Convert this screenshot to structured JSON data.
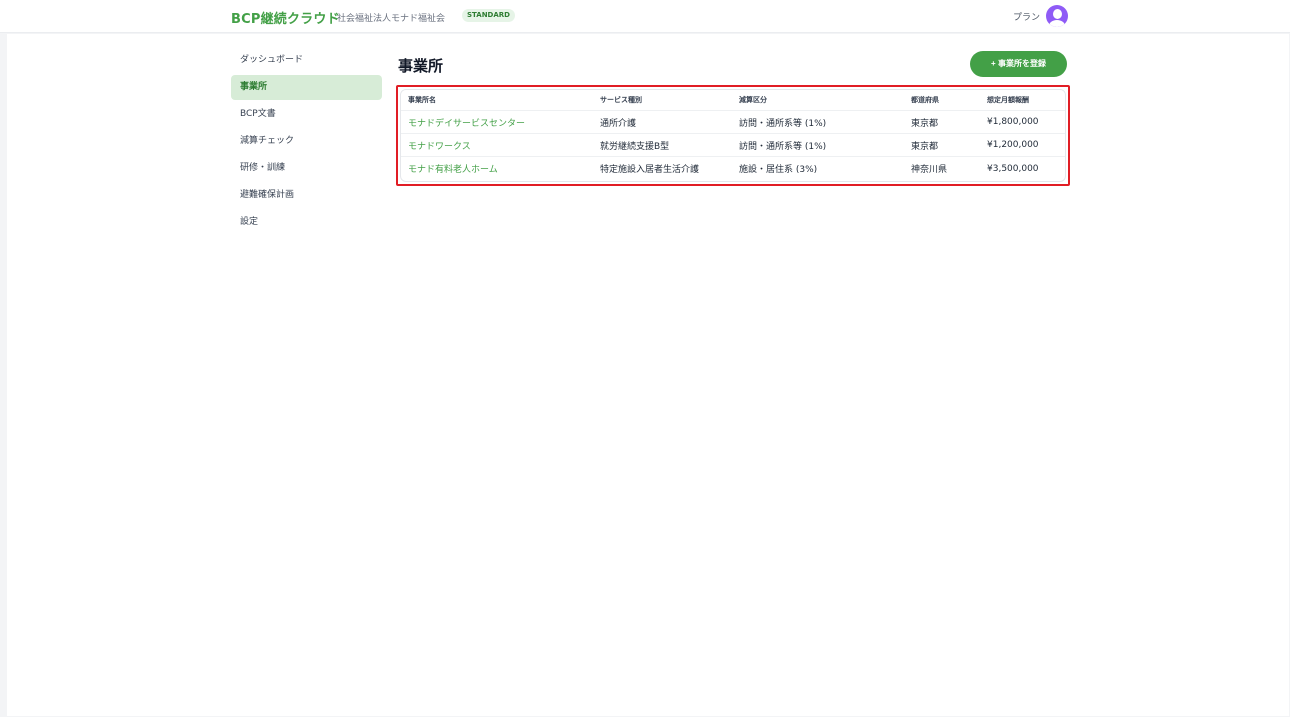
{
  "header": {
    "brand": "BCP継続クラウド",
    "organization": "社会福祉法人モナド福祉会",
    "plan_badge": "STANDARD",
    "plan_link": "プラン"
  },
  "sidebar": {
    "items": [
      {
        "label": "ダッシュボード",
        "active": false
      },
      {
        "label": "事業所",
        "active": true
      },
      {
        "label": "BCP文書",
        "active": false
      },
      {
        "label": "減算チェック",
        "active": false
      },
      {
        "label": "研修・訓練",
        "active": false
      },
      {
        "label": "避難確保計画",
        "active": false
      },
      {
        "label": "設定",
        "active": false
      }
    ]
  },
  "main": {
    "title": "事業所",
    "add_button": "+ 事業所を登録",
    "table": {
      "columns": [
        "事業所名",
        "サービス種別",
        "減算区分",
        "都道府県",
        "想定月額報酬"
      ],
      "rows": [
        {
          "name": "モナドデイサービスセンター",
          "service": "通所介護",
          "category": "訪問・通所系等 (1%)",
          "prefecture": "東京都",
          "fee": "¥1,800,000"
        },
        {
          "name": "モナドワークス",
          "service": "就労継続支援B型",
          "category": "訪問・通所系等 (1%)",
          "prefecture": "東京都",
          "fee": "¥1,200,000"
        },
        {
          "name": "モナド有料老人ホーム",
          "service": "特定施設入居者生活介護",
          "category": "施設・居住系 (3%)",
          "prefecture": "神奈川県",
          "fee": "¥3,500,000"
        }
      ]
    }
  },
  "colors": {
    "accent": "#43a047",
    "highlight_border": "#e11d25",
    "avatar": "#8f5bf6"
  }
}
